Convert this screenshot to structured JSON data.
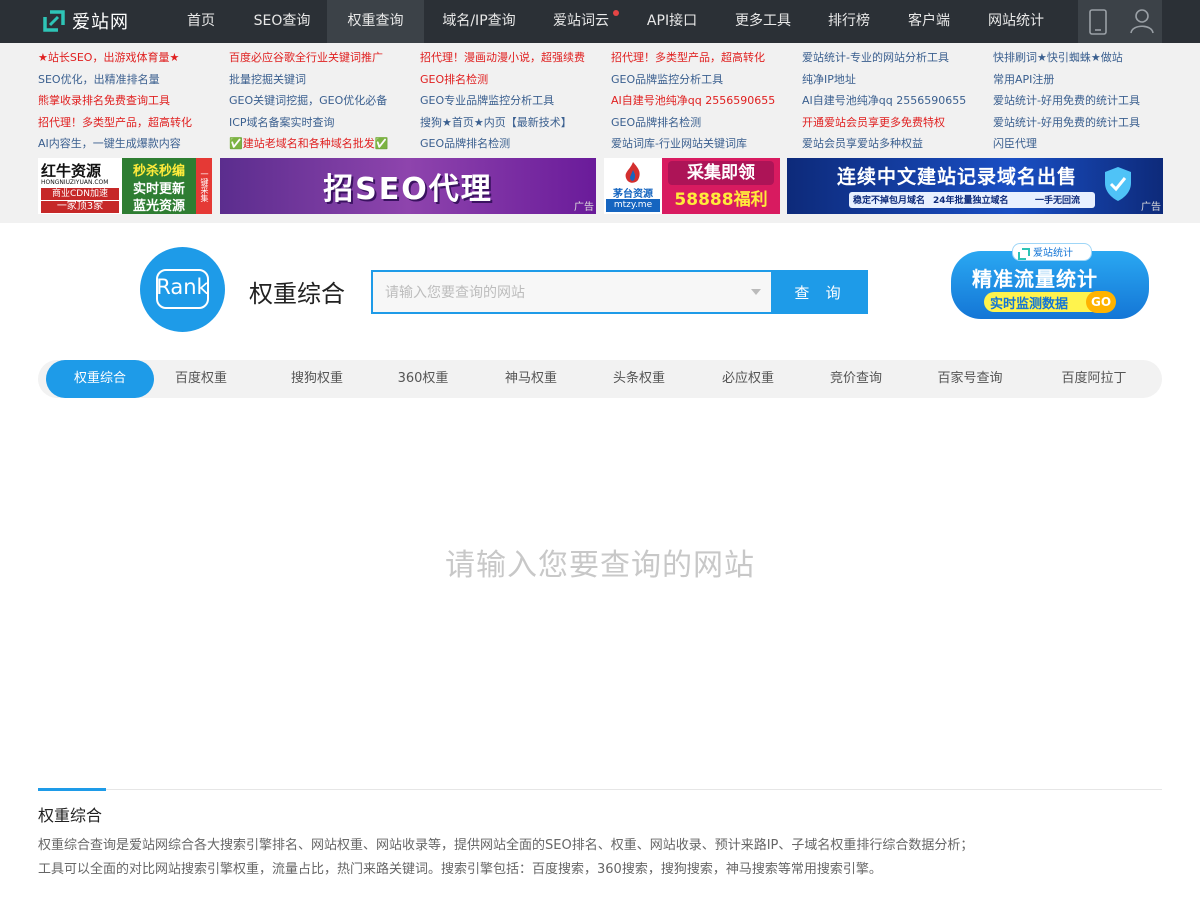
{
  "brand": {
    "name": "爱站网"
  },
  "nav": {
    "items": [
      {
        "label": "首页"
      },
      {
        "label": "SEO查询"
      },
      {
        "label": "权重查询"
      },
      {
        "label": "域名/IP查询"
      },
      {
        "label": "爱站词云"
      },
      {
        "label": "API接口"
      },
      {
        "label": "更多工具"
      },
      {
        "label": "排行榜"
      },
      {
        "label": "客户端"
      },
      {
        "label": "网站统计"
      }
    ],
    "active_index": 2,
    "right_icons": [
      "mobile-icon",
      "user-icon"
    ]
  },
  "ads": {
    "text_links": [
      {
        "text": "★站长SEO，出游戏体育量★",
        "color": "red"
      },
      {
        "text": "百度必应谷歌全行业关键词推广",
        "color": "red"
      },
      {
        "text": "招代理！漫画动漫小说，超强续费",
        "color": "red"
      },
      {
        "text": "招代理！多类型产品，超高转化",
        "color": "red"
      },
      {
        "text": "爱站统计-专业的网站分析工具",
        "color": "blue"
      },
      {
        "text": "快排刷词★快引蜘蛛★做站",
        "color": "blue"
      },
      {
        "text": "SEO优化，出精准排名量",
        "color": "blue"
      },
      {
        "text": "批量挖掘关键词",
        "color": "blue"
      },
      {
        "text": "GEO排名检测",
        "color": "red"
      },
      {
        "text": "GEO品牌监控分析工具",
        "color": "blue"
      },
      {
        "text": "纯净IP地址",
        "color": "blue"
      },
      {
        "text": "常用API注册",
        "color": "blue"
      },
      {
        "text": "熊掌收录排名免费查询工具",
        "color": "red"
      },
      {
        "text": "GEO关键词挖掘，GEO优化必备",
        "color": "blue"
      },
      {
        "text": "GEO专业品牌监控分析工具",
        "color": "blue"
      },
      {
        "text": "AI自建号池纯净qq 2556590655",
        "color": "red"
      },
      {
        "text": "AI自建号池纯净qq 2556590655",
        "color": "blue"
      },
      {
        "text": "爱站统计-好用免费的统计工具",
        "color": "blue"
      },
      {
        "text": "招代理！多类型产品，超高转化",
        "color": "red"
      },
      {
        "text": "ICP域名备案实时查询",
        "color": "blue"
      },
      {
        "text": "搜狗★首页★内页【最新技术】",
        "color": "blue"
      },
      {
        "text": "GEO品牌排名检测",
        "color": "blue"
      },
      {
        "text": "开通爱站会员享更多免费特权",
        "color": "red"
      },
      {
        "text": "爱站统计-好用免费的统计工具",
        "color": "blue"
      },
      {
        "text": "AI内容生，一键生成爆款内容",
        "color": "blue"
      },
      {
        "text": "✅建站老域名和各种域名批发✅",
        "color": "red"
      },
      {
        "text": "GEO品牌排名检测",
        "color": "blue"
      },
      {
        "text": "爱站词库-行业网站关键词库",
        "color": "blue"
      },
      {
        "text": "爱站会员享爱站多种权益",
        "color": "blue"
      },
      {
        "text": "闪臣代理",
        "color": "blue"
      }
    ],
    "banners": [
      {
        "name": "banner-hongniu",
        "line1": "红牛资源",
        "line2": "HONGNIUZIYUAN.COM",
        "line3": "商业CDN加速",
        "line4": "一家顶3家",
        "side1": "秒杀秒编",
        "side2": "实时更新",
        "side3": "蓝光资源",
        "tag": "一键采集"
      },
      {
        "name": "banner-seo-agent",
        "text": "招SEO代理",
        "tag": "广告"
      },
      {
        "name": "banner-mtzy",
        "brand": "茅台资源",
        "url": "mtzy.me",
        "line1": "采集即领",
        "line2": "58888福利"
      },
      {
        "name": "banner-domain",
        "title": "连续中文建站记录域名出售",
        "sub1": "稳定不掉包月域名",
        "sub2": "24年批量独立域名",
        "sub3": "一手无回流",
        "tag": "广告"
      }
    ],
    "stat_ad": {
      "badge": "爱站统计",
      "title": "精准流量统计",
      "sub": "实时监测数据",
      "go": "GO"
    }
  },
  "search": {
    "logo_text": "Rank",
    "title": "权重综合",
    "placeholder": "请输入您要查询的网站",
    "button": "查 询"
  },
  "tabs": {
    "items": [
      "权重综合",
      "百度权重",
      "搜狗权重",
      "360权重",
      "神马权重",
      "头条权重",
      "必应权重",
      "竞价查询",
      "百家号查询",
      "百度阿拉丁"
    ],
    "active_index": 0
  },
  "main": {
    "empty_hint": "请输入您要查询的网站"
  },
  "info": {
    "title": "权重综合",
    "line1": "权重综合查询是爱站网综合各大搜索引擎排名、网站权重、网站收录等，提供网站全面的SEO排名、权重、网站收录、预计来路IP、子域名权重排行综合数据分析；",
    "line2": "工具可以全面的对比网站搜索引擎权重，流量占比，热门来路关键词。搜索引擎包括：百度搜索，360搜索，搜狗搜索，神马搜索等常用搜索引擎。"
  },
  "colors": {
    "accent": "#1e9be8",
    "nav_bg": "#2b3036",
    "ad_red": "#e02020",
    "ad_blue": "#3a5f8f"
  }
}
